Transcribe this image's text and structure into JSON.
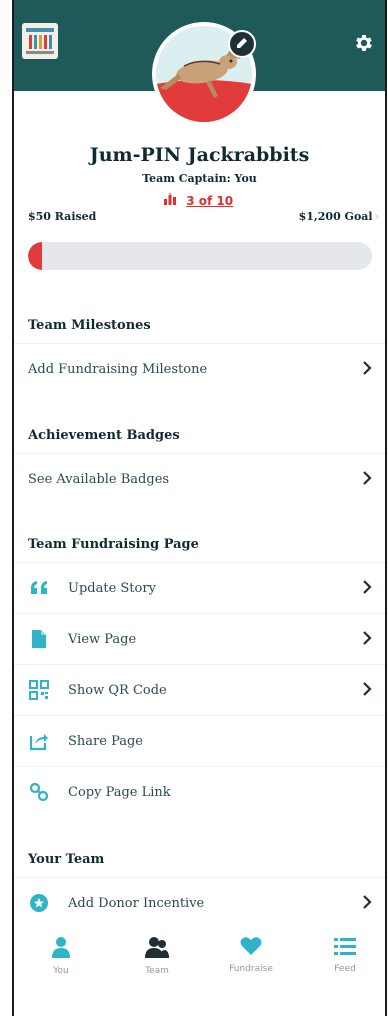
{
  "header": {
    "logo_icon": "event-logo-icon",
    "settings_icon": "gear-icon",
    "avatar_icon": "jackrabbit-avatar-icon",
    "edit_icon": "pencil-icon"
  },
  "team": {
    "name": "Jum-PIN Jackrabbits",
    "captain": "Team Captain: You",
    "rank": "3 of 10"
  },
  "progress": {
    "raised": "$50 Raised",
    "goal": "$1,200 Goal",
    "fraction": 0.042
  },
  "sections": {
    "milestones": {
      "title": "Team Milestones",
      "add": "Add Fundraising Milestone"
    },
    "badges": {
      "title": "Achievement Badges",
      "see": "See Available Badges"
    },
    "page": {
      "title": "Team Fundraising Page",
      "update": "Update Story",
      "view": "View Page",
      "qr": "Show QR Code",
      "share": "Share Page",
      "copy": "Copy Page Link"
    },
    "team": {
      "title": "Your Team",
      "incentive": "Add Donor Incentive"
    }
  },
  "tabs": [
    {
      "label": "You",
      "icon": "person-icon"
    },
    {
      "label": "Team",
      "icon": "team-icon"
    },
    {
      "label": "Fundraise",
      "icon": "heart-icon"
    },
    {
      "label": "Feed",
      "icon": "list-icon"
    }
  ],
  "colors": {
    "header": "#1f5a5a",
    "accent": "#2fb3c6",
    "progress": "#e23b3b",
    "rank": "#e03030"
  }
}
